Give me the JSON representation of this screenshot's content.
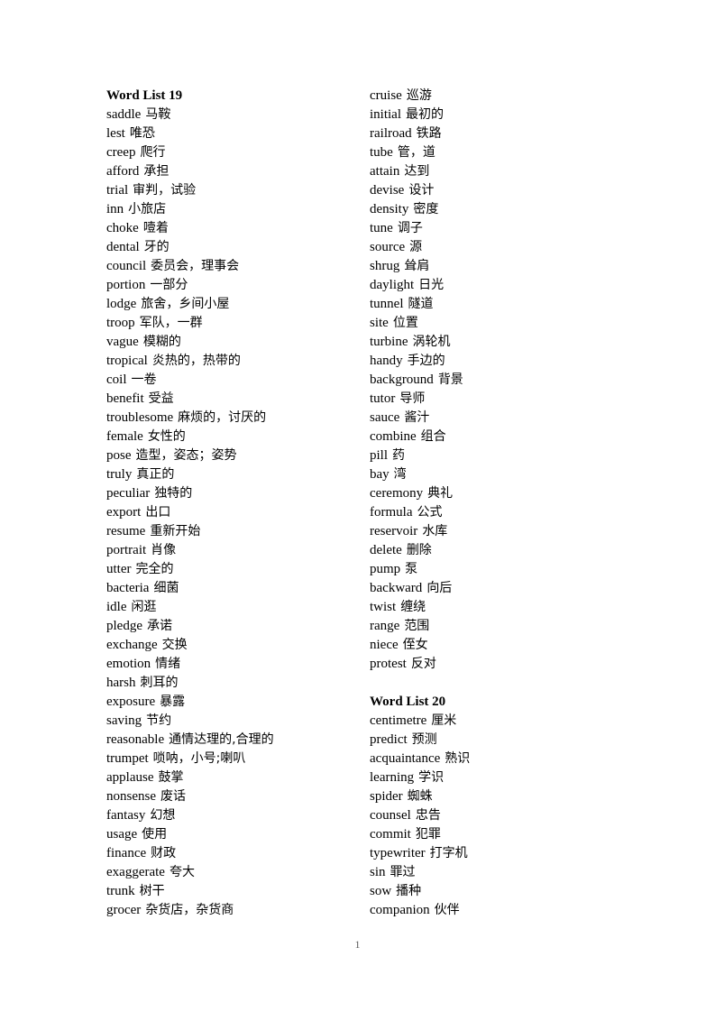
{
  "page": {
    "number": "1"
  },
  "columns": {
    "left": {
      "blocks": [
        {
          "type": "heading",
          "text": "Word List 19"
        },
        {
          "type": "entries",
          "items": [
            {
              "term": "saddle",
              "gloss": "马鞍"
            },
            {
              "term": "lest",
              "gloss": "唯恐"
            },
            {
              "term": "creep",
              "gloss": "爬行"
            },
            {
              "term": "afford",
              "gloss": "承担"
            },
            {
              "term": "trial",
              "gloss": "审判，试验"
            },
            {
              "term": "inn",
              "gloss": "小旅店"
            },
            {
              "term": "choke",
              "gloss": "噎着"
            },
            {
              "term": "dental",
              "gloss": "牙的"
            },
            {
              "term": "council",
              "gloss": "委员会，理事会"
            },
            {
              "term": "portion",
              "gloss": "一部分"
            },
            {
              "term": "lodge",
              "gloss": "旅舍，乡间小屋"
            },
            {
              "term": "troop",
              "gloss": "军队，一群"
            },
            {
              "term": "vague",
              "gloss": "模糊的"
            },
            {
              "term": "tropical",
              "gloss": "炎热的，热带的"
            },
            {
              "term": "coil",
              "gloss": "一卷"
            },
            {
              "term": "benefit",
              "gloss": "受益"
            },
            {
              "term": "troublesome",
              "gloss": "麻烦的，讨厌的"
            },
            {
              "term": "female",
              "gloss": "女性的"
            },
            {
              "term": "pose",
              "gloss": "造型，姿态；姿势"
            },
            {
              "term": "truly",
              "gloss": "真正的"
            },
            {
              "term": "peculiar",
              "gloss": "独特的"
            },
            {
              "term": "export",
              "gloss": "出口"
            },
            {
              "term": "resume",
              "gloss": "重新开始"
            },
            {
              "term": "portrait",
              "gloss": "肖像"
            },
            {
              "term": "utter",
              "gloss": "完全的"
            },
            {
              "term": "bacteria",
              "gloss": "细菌"
            },
            {
              "term": "idle",
              "gloss": "闲逛"
            },
            {
              "term": "pledge",
              "gloss": "承诺"
            },
            {
              "term": "exchange",
              "gloss": "交换"
            },
            {
              "term": "emotion",
              "gloss": "情绪"
            },
            {
              "term": "harsh",
              "gloss": "刺耳的"
            },
            {
              "term": "exposure",
              "gloss": "暴露"
            },
            {
              "term": "saving",
              "gloss": "节约"
            },
            {
              "term": "reasonable",
              "gloss": "通情达理的,合理的"
            },
            {
              "term": "trumpet",
              "gloss": "唢呐，小号;喇叭"
            },
            {
              "term": "applause",
              "gloss": "鼓掌"
            },
            {
              "term": "nonsense",
              "gloss": "废话"
            },
            {
              "term": "fantasy",
              "gloss": "幻想"
            },
            {
              "term": "usage",
              "gloss": "使用"
            },
            {
              "term": "finance",
              "gloss": "财政"
            },
            {
              "term": "exaggerate",
              "gloss": "夸大"
            },
            {
              "term": "trunk",
              "gloss": "树干"
            },
            {
              "term": "grocer",
              "gloss": "杂货店，杂货商"
            }
          ]
        }
      ]
    },
    "right": {
      "blocks": [
        {
          "type": "entries",
          "items": [
            {
              "term": "cruise",
              "gloss": "巡游"
            },
            {
              "term": "initial",
              "gloss": "最初的"
            },
            {
              "term": "railroad",
              "gloss": "铁路"
            },
            {
              "term": "tube",
              "gloss": "管，道"
            },
            {
              "term": "attain",
              "gloss": "达到"
            },
            {
              "term": "devise",
              "gloss": "设计"
            },
            {
              "term": "density",
              "gloss": "密度"
            },
            {
              "term": "tune",
              "gloss": "调子"
            },
            {
              "term": "source",
              "gloss": "源"
            },
            {
              "term": "shrug",
              "gloss": "耸肩"
            },
            {
              "term": "daylight",
              "gloss": "日光"
            },
            {
              "term": "tunnel",
              "gloss": "隧道"
            },
            {
              "term": "site",
              "gloss": "位置"
            },
            {
              "term": "turbine",
              "gloss": "涡轮机"
            },
            {
              "term": "handy",
              "gloss": "手边的"
            },
            {
              "term": "background",
              "gloss": "背景"
            },
            {
              "term": "tutor",
              "gloss": "导师"
            },
            {
              "term": "sauce",
              "gloss": "酱汁"
            },
            {
              "term": "combine",
              "gloss": "组合"
            },
            {
              "term": "pill",
              "gloss": "药"
            },
            {
              "term": "bay",
              "gloss": "湾"
            },
            {
              "term": "ceremony",
              "gloss": "典礼"
            },
            {
              "term": "formula",
              "gloss": "公式"
            },
            {
              "term": "reservoir",
              "gloss": "水库"
            },
            {
              "term": "delete",
              "gloss": "删除"
            },
            {
              "term": "pump",
              "gloss": "泵"
            },
            {
              "term": "backward",
              "gloss": "向后"
            },
            {
              "term": "twist",
              "gloss": "缠绕"
            },
            {
              "term": "range",
              "gloss": "范围"
            },
            {
              "term": "niece",
              "gloss": "侄女"
            },
            {
              "term": "protest",
              "gloss": "反对"
            }
          ]
        },
        {
          "type": "spacer"
        },
        {
          "type": "heading",
          "text": "Word List 20"
        },
        {
          "type": "entries",
          "items": [
            {
              "term": "centimetre",
              "gloss": "厘米"
            },
            {
              "term": "predict",
              "gloss": "预测"
            },
            {
              "term": "acquaintance",
              "gloss": "熟识"
            },
            {
              "term": "learning",
              "gloss": "学识"
            },
            {
              "term": "spider",
              "gloss": "蜘蛛"
            },
            {
              "term": "counsel",
              "gloss": "忠告"
            },
            {
              "term": "commit",
              "gloss": "犯罪"
            },
            {
              "term": "typewriter",
              "gloss": "打字机"
            },
            {
              "term": "sin",
              "gloss": "罪过"
            },
            {
              "term": "sow",
              "gloss": "播种"
            },
            {
              "term": "companion",
              "gloss": "伙伴"
            }
          ]
        }
      ]
    }
  }
}
